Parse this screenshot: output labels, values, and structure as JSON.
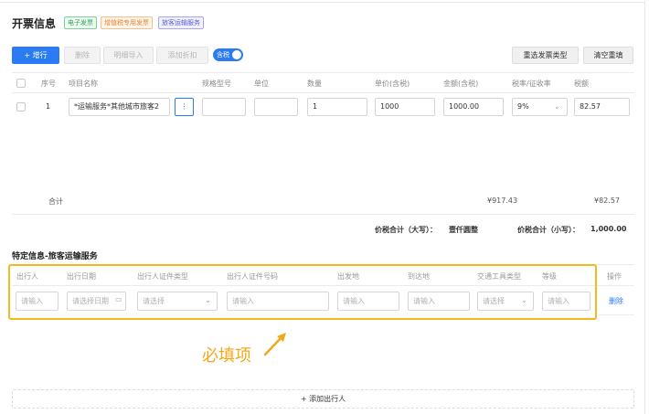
{
  "header": {
    "title": "开票信息",
    "tags": [
      "电子发票",
      "增值税专用发票",
      "旅客运输服务"
    ]
  },
  "toolbar": {
    "add_row": "+ 增行",
    "delete": "删除",
    "detail_import": "明细导入",
    "add_discount": "添加折扣",
    "tax_toggle": "含税",
    "reselect_type": "重选发票类型",
    "clear_fill": "清空重填"
  },
  "items_table": {
    "columns": [
      "序号",
      "项目名称",
      "规格型号",
      "单位",
      "数量",
      "单价(含税)",
      "金额(含税)",
      "税率/征收率",
      "税额"
    ],
    "rows": [
      {
        "seq": "1",
        "name": "*运输服务*其他城市旅客2",
        "spec": "",
        "unit": "",
        "quantity": "1",
        "unit_price": "1000",
        "amount": "1000.00",
        "tax_rate": "9%",
        "tax": "82.57"
      }
    ],
    "totals": {
      "label": "合计",
      "amount": "¥917.43",
      "tax": "¥82.57"
    },
    "grand_total": {
      "upper_label": "价税合计（大写）：",
      "upper_value": "壹仟圆整",
      "lower_label": "价税合计（小写）：",
      "lower_value": "1,000.00"
    }
  },
  "traveler_section": {
    "title": "特定信息-旅客运输服务",
    "columns": [
      "出行人",
      "出行日期",
      "出行人证件类型",
      "出行人证件号码",
      "出发地",
      "到达地",
      "交通工具类型",
      "等级",
      "操作"
    ],
    "row": {
      "traveler": "请输入",
      "date": "请选择日期",
      "id_type": "请选择",
      "id_number": "请输入",
      "departure": "请输入",
      "arrival": "请输入",
      "vehicle": "请选择",
      "level": "请输入",
      "action": "删除"
    },
    "add_traveler": "+ 添加出行人"
  },
  "annotation": {
    "text": "必填项",
    "color": "#f0a818"
  }
}
